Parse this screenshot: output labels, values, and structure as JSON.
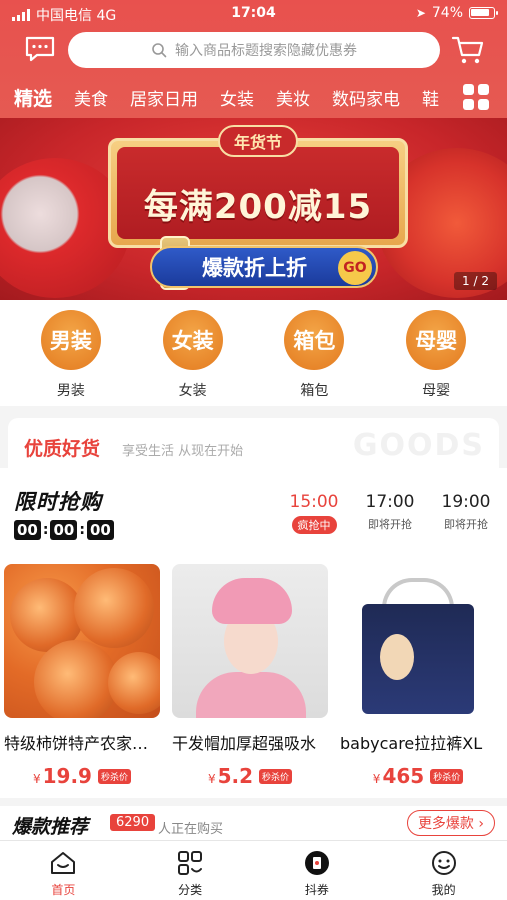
{
  "status_bar": {
    "carrier": "中国电信 4G",
    "time": "17:04",
    "battery_pct": "74%"
  },
  "header": {
    "search_placeholder": "输入商品标题搜索隐藏优惠券"
  },
  "tabs": [
    {
      "label": "精选",
      "active": true
    },
    {
      "label": "美食",
      "active": false
    },
    {
      "label": "居家日用",
      "active": false
    },
    {
      "label": "女装",
      "active": false
    },
    {
      "label": "美妆",
      "active": false
    },
    {
      "label": "数码家电",
      "active": false
    },
    {
      "label": "鞋",
      "active": false
    }
  ],
  "banner": {
    "pill": "年货节",
    "headline": "每满200减15",
    "cta": "爆款折上折",
    "go": "GO",
    "pager": "1 / 2"
  },
  "categories": [
    {
      "circle": "男装",
      "label": "男装"
    },
    {
      "circle": "女装",
      "label": "女装"
    },
    {
      "circle": "箱包",
      "label": "箱包"
    },
    {
      "circle": "母婴",
      "label": "母婴"
    }
  ],
  "quality": {
    "title": "优质好货",
    "subtitle": "享受生活 从现在开始",
    "ghost": "GOODS"
  },
  "flash_sale": {
    "label": "限时抢购",
    "timer": [
      "00",
      "00",
      "00"
    ],
    "slots": [
      {
        "time": "15:00",
        "status": "疯抢中",
        "active": true
      },
      {
        "time": "17:00",
        "status": "即将开抢",
        "active": false
      },
      {
        "time": "19:00",
        "status": "即将开抢",
        "active": false
      }
    ],
    "products": [
      {
        "name": "特级柿饼特产农家自制",
        "currency": "¥",
        "price": "19.9",
        "tag": "秒杀价"
      },
      {
        "name": "干发帽加厚超强吸水",
        "currency": "¥",
        "price": "5.2",
        "tag": "秒杀价"
      },
      {
        "name": "babycare拉拉裤XL",
        "currency": "¥",
        "price": "465",
        "tag": "秒杀价"
      }
    ]
  },
  "hot": {
    "label": "爆款推荐",
    "count": "6290",
    "buying": "人正在购买",
    "more": "更多爆款 ›"
  },
  "bottom_nav": [
    {
      "label": "首页",
      "icon": "home-icon",
      "active": true
    },
    {
      "label": "分类",
      "icon": "category-icon",
      "active": false
    },
    {
      "label": "抖券",
      "icon": "douyin-icon",
      "active": false
    },
    {
      "label": "我的",
      "icon": "profile-icon",
      "active": false
    }
  ],
  "colors": {
    "accent": "#e8433c",
    "header": "#e8514e",
    "category_circle": "#e37a1f"
  }
}
